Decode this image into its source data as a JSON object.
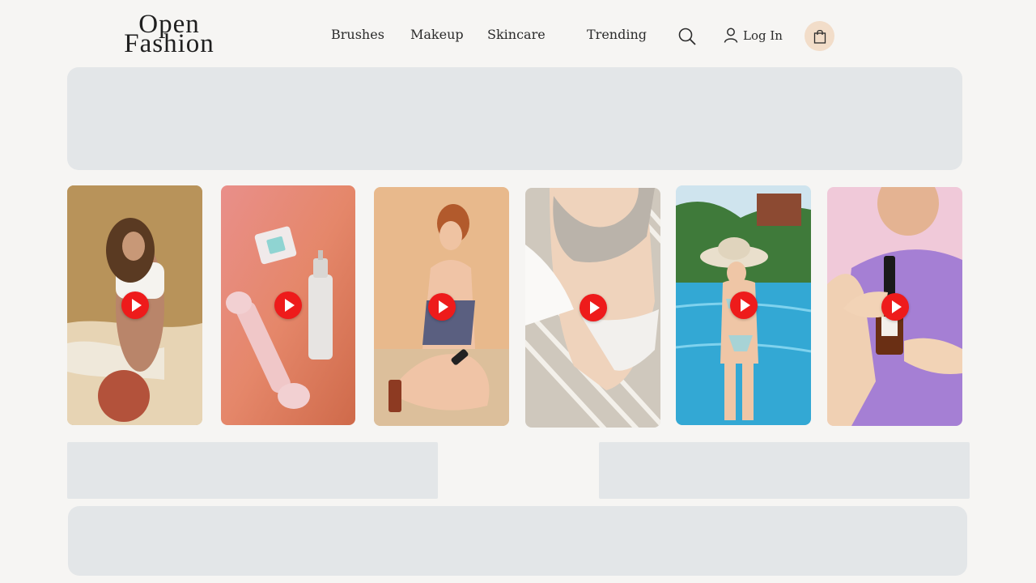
{
  "brand": {
    "line1": "Open",
    "line2": "Fashion"
  },
  "nav": {
    "brushes": "Brushes",
    "makeup": "Makeup",
    "skincare": "Skincare",
    "trending": "Trending"
  },
  "header": {
    "login_label": "Log In",
    "search_icon": "search-icon",
    "user_icon": "user-icon",
    "cart_icon": "shopping-bag-icon"
  },
  "colors": {
    "play": "#ee1b1b",
    "cart_bg": "#f2ddc9",
    "placeholder": "#e3e6e8",
    "background": "#f6f5f3"
  },
  "videos": [
    {
      "id": "beach-woman",
      "icon": "play-icon"
    },
    {
      "id": "serum-roller",
      "icon": "play-icon"
    },
    {
      "id": "sunscreen-sand",
      "icon": "play-icon"
    },
    {
      "id": "swimsuit-towel",
      "icon": "play-icon"
    },
    {
      "id": "pool-hat",
      "icon": "play-icon"
    },
    {
      "id": "dropper-bottle",
      "icon": "play-icon"
    }
  ]
}
